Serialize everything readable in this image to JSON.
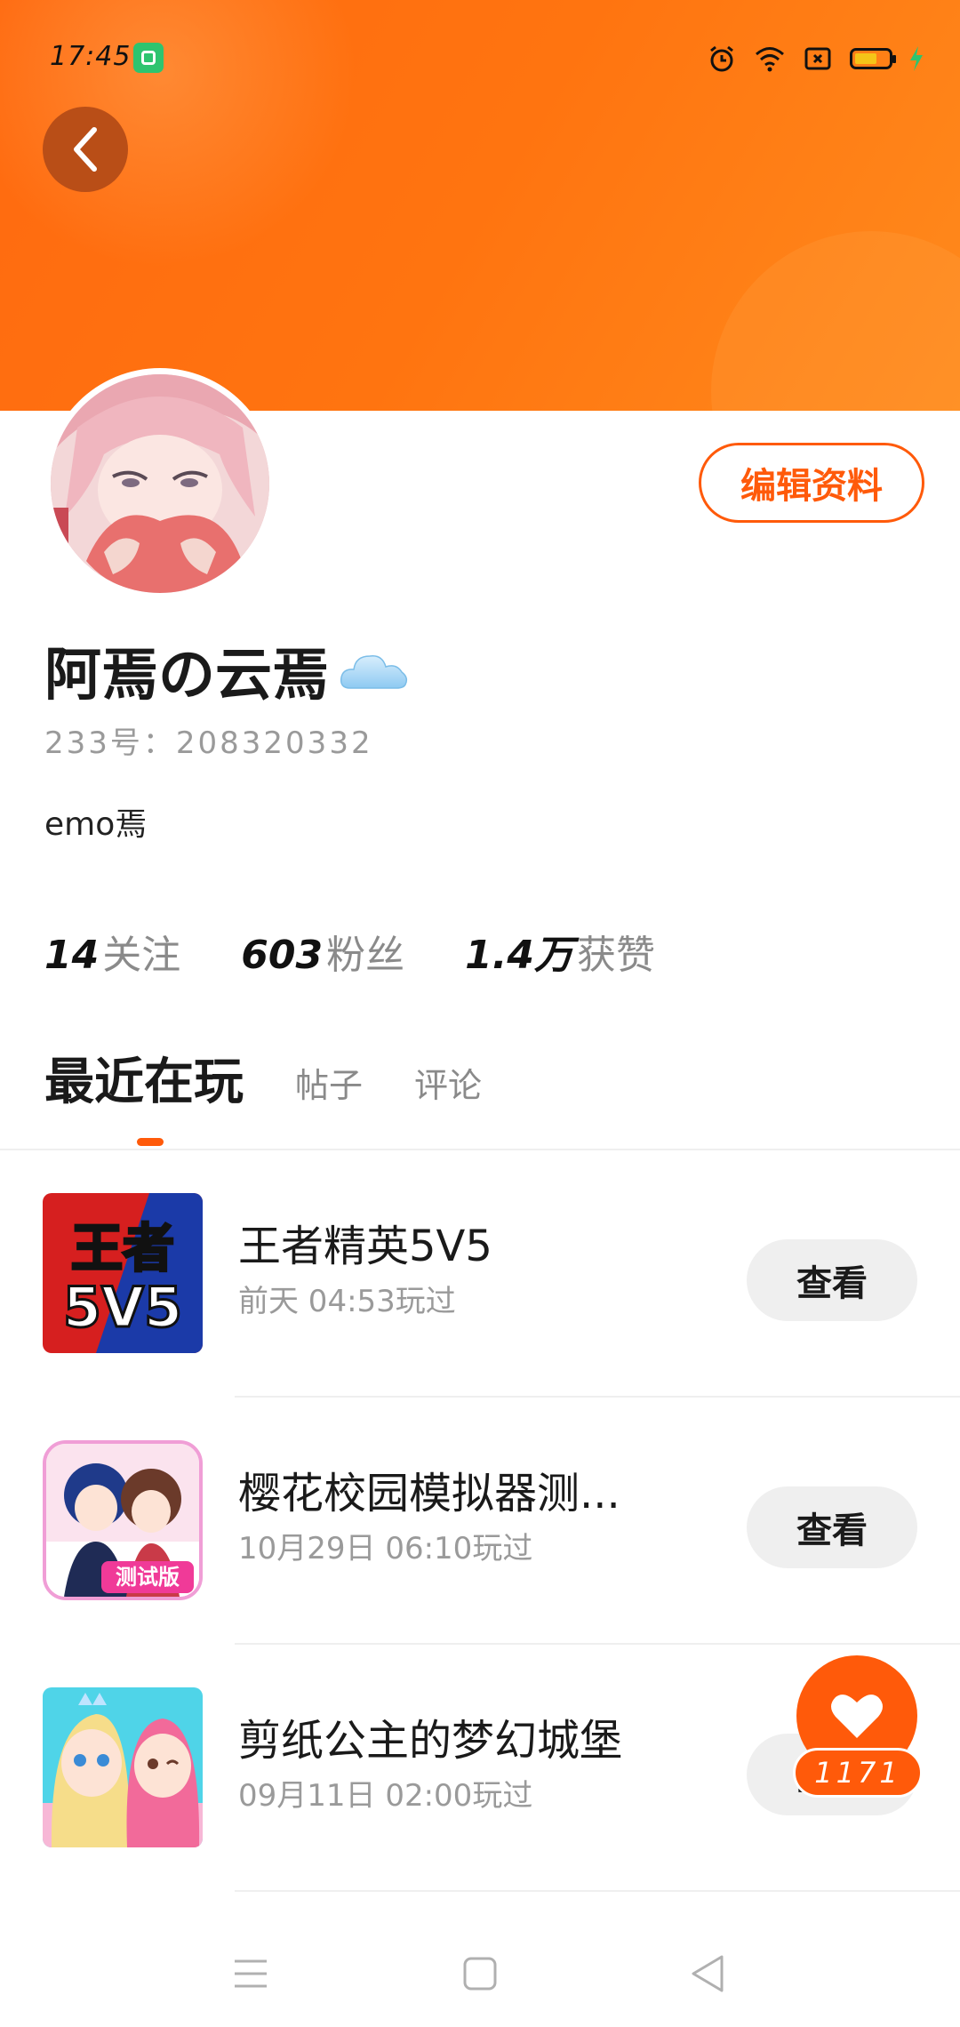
{
  "status_bar": {
    "time": "17:45"
  },
  "profile": {
    "edit_label": "编辑资料",
    "username": "阿焉の云焉",
    "user_id": "233号：208320332",
    "bio": "emo焉",
    "stats": [
      {
        "num": "14",
        "label": "关注"
      },
      {
        "num": "603",
        "label": "粉丝"
      },
      {
        "num": "1.4万",
        "label": "获赞"
      }
    ]
  },
  "tabs": [
    {
      "label": "最近在玩",
      "active": true
    },
    {
      "label": "帖子",
      "active": false
    },
    {
      "label": "评论",
      "active": false
    }
  ],
  "games": [
    {
      "title": "王者精英5V5",
      "time": "前天 04:53玩过",
      "button": "查看",
      "icon_text_top": "王者",
      "icon_text_bottom": "5V5"
    },
    {
      "title": "樱花校园模拟器测...",
      "time": "10月29日 06:10玩过",
      "button": "查看",
      "icon_badge": "测试版"
    },
    {
      "title": "剪纸公主的梦幻城堡",
      "time": "09月11日 02:00玩过",
      "button": "查看"
    }
  ],
  "like_fab": {
    "count": "1171"
  },
  "colors": {
    "accent": "#ff5a0a",
    "header": "#ff7410"
  }
}
